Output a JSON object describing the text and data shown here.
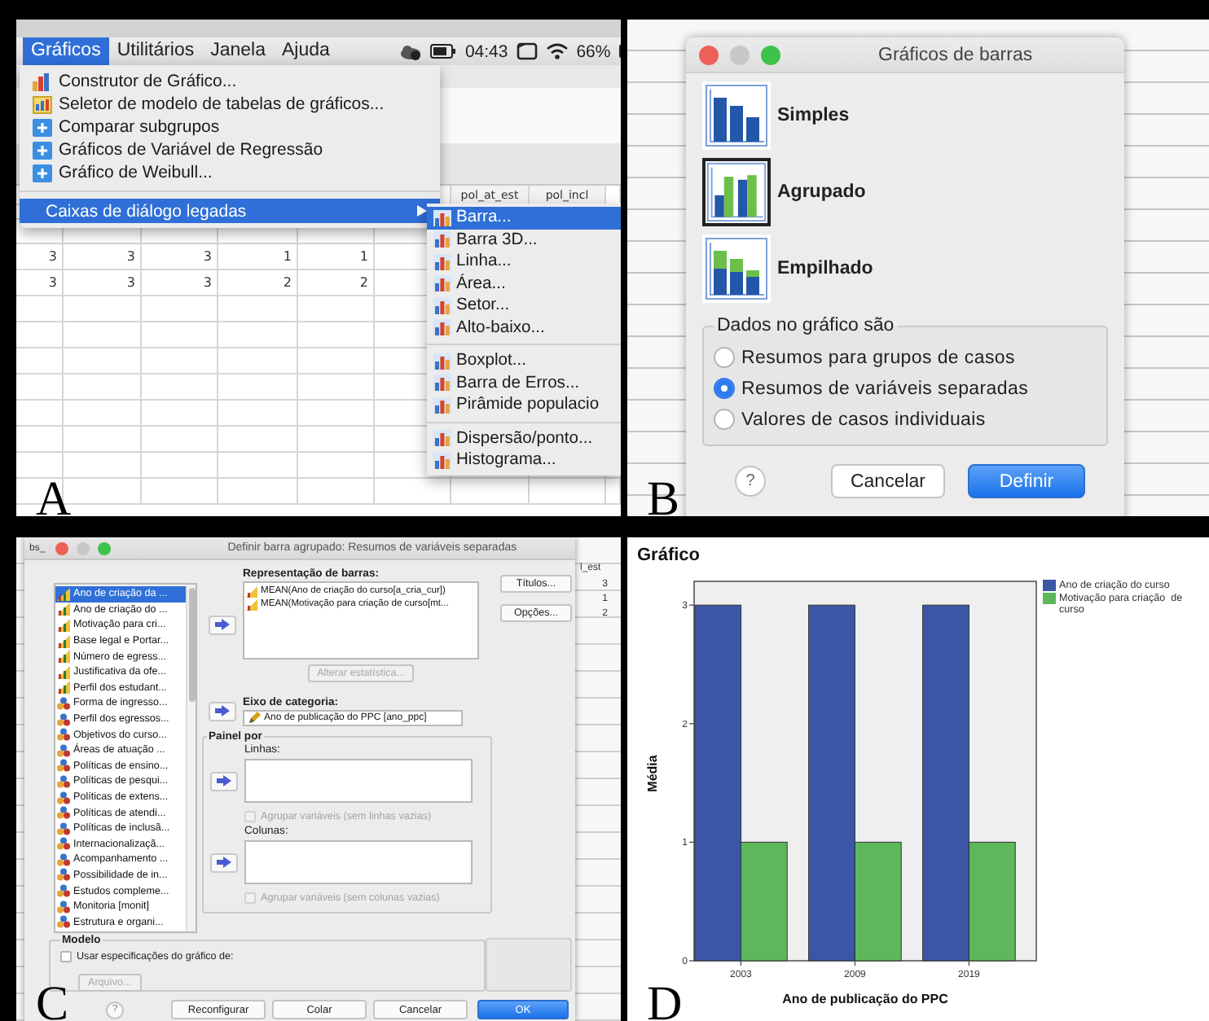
{
  "panel_a": {
    "label": "A",
    "menubar": [
      {
        "label": "Gráficos",
        "selected": true
      },
      {
        "label": "Utilitários",
        "selected": false
      },
      {
        "label": "Janela",
        "selected": false
      },
      {
        "label": "Ajuda",
        "selected": false
      }
    ],
    "status": {
      "clock": "04:43",
      "battery": "66%"
    },
    "grid": {
      "columns": [
        "pol_at_est",
        "pol_incl"
      ],
      "rows": [
        [
          "3",
          "3",
          "3",
          "1",
          "1"
        ],
        [
          "3",
          "3",
          "3",
          "2",
          "2"
        ]
      ]
    },
    "menu": [
      {
        "label": "Construtor de Gráfico...",
        "kind": "chart",
        "selected": false
      },
      {
        "label": "Seletor de modelo de tabelas de gráficos...",
        "kind": "template",
        "selected": false
      },
      {
        "label": "Comparar subgrupos",
        "kind": "plus",
        "selected": false
      },
      {
        "label": "Gráficos de Variável de Regressão",
        "kind": "plus",
        "selected": false
      },
      {
        "label": "Gráfico de Weibull...",
        "kind": "plus",
        "selected": false
      },
      {
        "label": "Caixas de diálogo legadas",
        "kind": "submenu",
        "selected": true
      }
    ],
    "submenu": [
      {
        "items": [
          {
            "label": "Barra...",
            "selected": true
          },
          {
            "label": "Barra 3D...",
            "selected": false
          },
          {
            "label": "Linha...",
            "selected": false
          },
          {
            "label": "Área...",
            "selected": false
          },
          {
            "label": "Setor...",
            "selected": false
          },
          {
            "label": "Alto-baixo...",
            "selected": false
          }
        ]
      },
      {
        "items": [
          {
            "label": "Boxplot...",
            "selected": false
          },
          {
            "label": "Barra de Erros...",
            "selected": false
          },
          {
            "label": "Pirâmide populacio",
            "selected": false
          }
        ]
      },
      {
        "items": [
          {
            "label": "Dispersão/ponto...",
            "selected": false
          },
          {
            "label": "Histograma...",
            "selected": false
          }
        ]
      }
    ]
  },
  "panel_b": {
    "label": "B",
    "dialog": {
      "title": "Gráficos de barras",
      "chart_types": [
        {
          "label": "Simples",
          "kind": "simple",
          "selected": false
        },
        {
          "label": "Agrupado",
          "kind": "clustered",
          "selected": true
        },
        {
          "label": "Empilhado",
          "kind": "stacked",
          "selected": false
        }
      ],
      "group": {
        "title": "Dados no gráfico são",
        "options": [
          {
            "label": "Resumos para grupos de casos",
            "selected": false
          },
          {
            "label": "Resumos de variáveis separadas",
            "selected": true
          },
          {
            "label": "Valores de casos individuais",
            "selected": false
          }
        ]
      },
      "buttons": [
        {
          "label": "?",
          "kind": "help"
        },
        {
          "label": "Cancelar",
          "kind": "normal"
        },
        {
          "label": "Definir",
          "kind": "default"
        }
      ]
    }
  },
  "panel_c": {
    "label": "C",
    "sheet": {
      "tab": "bs_",
      "column": "l_est",
      "cells": [
        "3",
        "1",
        "2"
      ]
    },
    "dialog": {
      "title": "Definir barra agrupado: Resumos de variáveis separadas",
      "variables": [
        {
          "label": "Ano de criação da ...",
          "kind": "scale",
          "selected": true
        },
        {
          "label": "Ano de criação do ...",
          "kind": "scale",
          "selected": false
        },
        {
          "label": "Motivação para cri...",
          "kind": "scale",
          "selected": false
        },
        {
          "label": "Base legal e Portar...",
          "kind": "scale",
          "selected": false
        },
        {
          "label": "Número de egress...",
          "kind": "scale",
          "selected": false
        },
        {
          "label": "Justificativa da ofe...",
          "kind": "scale",
          "selected": false
        },
        {
          "label": "Perfil dos estudant...",
          "kind": "scale",
          "selected": false
        },
        {
          "label": "Forma de ingresso...",
          "kind": "nominal",
          "selected": false
        },
        {
          "label": "Perfil dos egressos...",
          "kind": "nominal",
          "selected": false
        },
        {
          "label": "Objetivos do curso...",
          "kind": "nominal",
          "selected": false
        },
        {
          "label": "Áreas de atuação ...",
          "kind": "nominal",
          "selected": false
        },
        {
          "label": "Políticas de ensino...",
          "kind": "nominal",
          "selected": false
        },
        {
          "label": "Políticas de pesqui...",
          "kind": "nominal",
          "selected": false
        },
        {
          "label": "Políticas de extens...",
          "kind": "nominal",
          "selected": false
        },
        {
          "label": "Políticas de atendi...",
          "kind": "nominal",
          "selected": false
        },
        {
          "label": "Políticas de inclusã...",
          "kind": "nominal",
          "selected": false
        },
        {
          "label": "Internacionalizaçã...",
          "kind": "nominal",
          "selected": false
        },
        {
          "label": "Acompanhamento ...",
          "kind": "nominal",
          "selected": false
        },
        {
          "label": "Possibilidade de in...",
          "kind": "nominal",
          "selected": false
        },
        {
          "label": "Estudos compleme...",
          "kind": "nominal",
          "selected": false
        },
        {
          "label": "Monitoria [monit]",
          "kind": "nominal",
          "selected": false
        },
        {
          "label": "Estrutura e organi...",
          "kind": "nominal",
          "selected": false
        }
      ],
      "bars_label": "Representação de barras:",
      "bars": [
        "MEAN(Ano de criação do curso[a_cria_cur])",
        "MEAN(Motivação para criação  de curso[mt..."
      ],
      "change_stat": {
        "label": "Alterar estatística...",
        "disabled": true
      },
      "category_label": "Eixo de categoria:",
      "category_value": "Ano de publicação do PPC  [ano_ppc]",
      "panel_title": "Painel por",
      "rows_label": "Linhas:",
      "rows_nest": {
        "label": "Agrupar variáveis (sem linhas vazias)",
        "checked": false,
        "disabled": true
      },
      "columns_label": "Colunas:",
      "columns_nest": {
        "label": "Agrupar variáveis (sem colunas vazias)",
        "checked": false,
        "disabled": true
      },
      "side_buttons": [
        "Títulos...",
        "Opções..."
      ],
      "template": {
        "title": "Modelo",
        "use": {
          "label": "Usar especificações do gráfico de:",
          "checked": false
        },
        "file": {
          "label": "Arquivo...",
          "disabled": true
        }
      },
      "buttons": [
        {
          "label": "?",
          "kind": "help"
        },
        {
          "label": "Reconfigurar",
          "kind": "normal"
        },
        {
          "label": "Colar",
          "kind": "normal"
        },
        {
          "label": "Cancelar",
          "kind": "normal"
        },
        {
          "label": "OK",
          "kind": "default"
        }
      ]
    }
  },
  "panel_d": {
    "label": "D",
    "heading": "Gráfico",
    "chart_data": {
      "type": "bar",
      "xlabel": "Ano de publicação do PPC",
      "ylabel": "Média",
      "categories": [
        "2003",
        "2009",
        "2019"
      ],
      "series": [
        {
          "name": "Ano de criação do curso",
          "color": "#3b56a5",
          "values": [
            3,
            3,
            3
          ]
        },
        {
          "name": "Motivação para criação  de curso",
          "color": "#5cb85a",
          "values": [
            1,
            1,
            1
          ]
        }
      ],
      "ylim": [
        0,
        3.2
      ],
      "yticks": [
        0,
        1,
        2,
        3
      ]
    }
  }
}
